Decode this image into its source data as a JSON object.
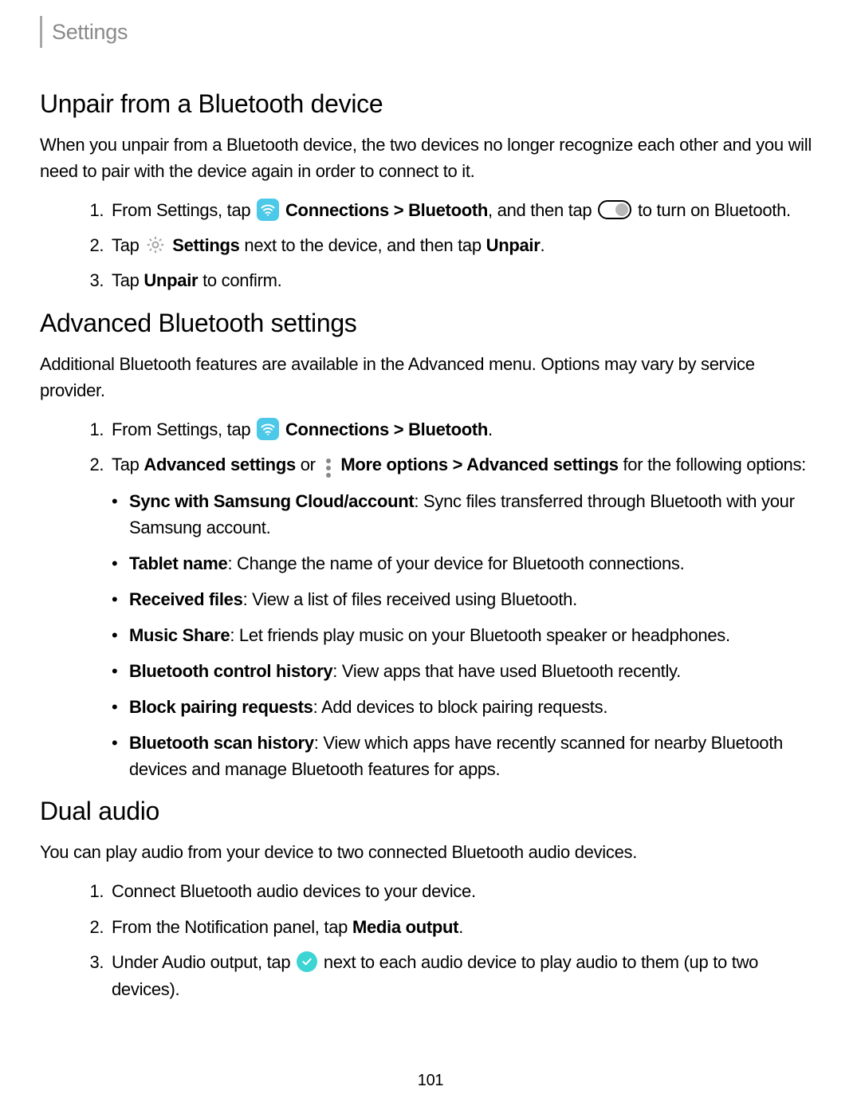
{
  "header": {
    "title": "Settings"
  },
  "section1": {
    "heading": "Unpair from a Bluetooth device",
    "intro": "When you unpair from a Bluetooth device, the two devices no longer recognize each other and you will need to pair with the device again in order to connect to it.",
    "step1a": "From Settings, tap ",
    "step1b_bold": "Connections > Bluetooth",
    "step1c": ", and then tap ",
    "step1d": " to turn on Bluetooth.",
    "step2a": "Tap ",
    "step2b_bold": "Settings",
    "step2c": " next to the device, and then tap ",
    "step2d_bold": "Unpair",
    "step2e": ".",
    "step3a": "Tap ",
    "step3b_bold": "Unpair",
    "step3c": " to confirm."
  },
  "section2": {
    "heading": "Advanced Bluetooth settings",
    "intro": "Additional Bluetooth features are available in the Advanced menu. Options may vary by service provider.",
    "step1a": "From Settings, tap ",
    "step1b_bold": "Connections > Bluetooth",
    "step1c": ".",
    "step2a": "Tap ",
    "step2b_bold": "Advanced settings",
    "step2c": " or ",
    "step2d_bold": "More options > Advanced settings",
    "step2e": " for the following options:",
    "bullets": [
      {
        "label": "Sync with Samsung Cloud/account",
        "desc": ": Sync files transferred through Bluetooth with your Samsung account."
      },
      {
        "label": "Tablet name",
        "desc": ": Change the name of your device for Bluetooth connections."
      },
      {
        "label": "Received files",
        "desc": ": View a list of files received using Bluetooth."
      },
      {
        "label": "Music Share",
        "desc": ": Let friends play music on your Bluetooth speaker or headphones."
      },
      {
        "label": "Bluetooth control history",
        "desc": ": View apps that have used Bluetooth recently."
      },
      {
        "label": "Block pairing requests",
        "desc": ": Add devices to block pairing requests."
      },
      {
        "label": "Bluetooth scan history",
        "desc": ": View which apps have recently scanned for nearby Bluetooth devices and manage Bluetooth features for apps."
      }
    ]
  },
  "section3": {
    "heading": "Dual audio",
    "intro": "You can play audio from your device to two connected Bluetooth audio devices.",
    "step1": "Connect Bluetooth audio devices to your device.",
    "step2a": "From the Notification panel, tap ",
    "step2b_bold": "Media output",
    "step2c": ".",
    "step3a": "Under Audio output, tap ",
    "step3b": " next to each audio device to play audio to them (up to two devices)."
  },
  "page_number": "101"
}
